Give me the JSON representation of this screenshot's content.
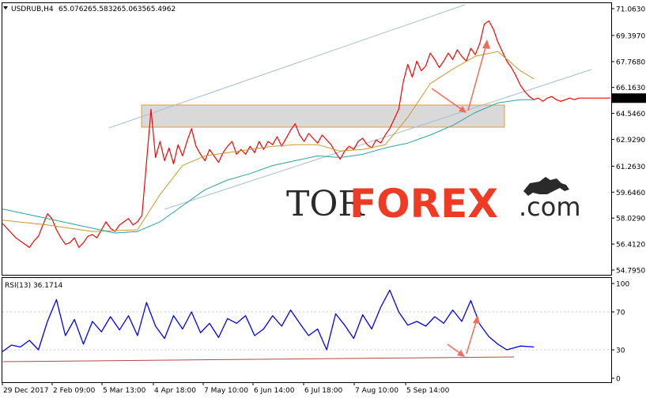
{
  "chart_data": [
    {
      "type": "line",
      "panel": "price",
      "title": "USDRUB,H4",
      "ohlc_header": [
        "65.0762",
        "65.5832",
        "65.0635",
        "65.4962"
      ],
      "y_tick_labels": [
        "71.0630",
        "69.3970",
        "67.7680",
        "66.1630",
        "65.4962",
        "64.5460",
        "62.9290",
        "61.2630",
        "59.6460",
        "58.0290",
        "56.4120",
        "54.7950"
      ],
      "last_price": "65.4962",
      "ylim": [
        54.795,
        71.063
      ],
      "x_tick_labels": [
        "29 Dec 2017",
        "2 Feb 09:00",
        "5 Mar 13:00",
        "4 Apr 18:00",
        "7 May 10:00",
        "6 Jun 14:00",
        "6 Jul 18:00",
        "7 Aug 10:00",
        "5 Sep 14:00"
      ],
      "series": [
        {
          "color": "#ff0000",
          "x": [
            0,
            2,
            4,
            6,
            8,
            10,
            12,
            14,
            16,
            18,
            20,
            22,
            24,
            26,
            28,
            30,
            32,
            34,
            36,
            38,
            40,
            42,
            44,
            46,
            48,
            50,
            52,
            54,
            56,
            58,
            60,
            62,
            64,
            66,
            68,
            70,
            72,
            74,
            76,
            78,
            80,
            82,
            84,
            86,
            88,
            90,
            92,
            94,
            96,
            98,
            100,
            102,
            104,
            106,
            108,
            110,
            112,
            114,
            116,
            118,
            120,
            122,
            124,
            126,
            128,
            130,
            132,
            134,
            136,
            138,
            140,
            142,
            144,
            146,
            148,
            150,
            152,
            154,
            156,
            158,
            160,
            162,
            164,
            166,
            168,
            170,
            172,
            174,
            176,
            178,
            180,
            182,
            184,
            186,
            188,
            190,
            192,
            194,
            196,
            198,
            200,
            202,
            204,
            206,
            208,
            210,
            212,
            214,
            216,
            218,
            220,
            222,
            224,
            226,
            228,
            230,
            232,
            234,
            236,
            238,
            240,
            242,
            244,
            246,
            248,
            250,
            252,
            254,
            256,
            258,
            260,
            262,
            264,
            266,
            268,
            270
          ],
          "y": [
            57.7,
            57.4,
            57.1,
            56.8,
            56.6,
            56.4,
            56.2,
            56.6,
            56.9,
            57.6,
            58.3,
            58.0,
            57.3,
            56.8,
            56.4,
            56.5,
            56.8,
            56.2,
            56.5,
            56.9,
            57.0,
            56.8,
            57.3,
            57.8,
            57.4,
            57.2,
            57.6,
            57.8,
            58.0,
            57.6,
            57.8,
            58.2,
            61.5,
            64.8,
            61.8,
            62.8,
            61.6,
            62.4,
            61.4,
            62.6,
            61.9,
            62.8,
            63.6,
            62.5,
            62.0,
            61.6,
            62.3,
            61.9,
            61.5,
            62.1,
            62.5,
            62.8,
            62.0,
            62.3,
            62.0,
            62.5,
            62.1,
            62.8,
            62.3,
            62.8,
            62.6,
            63.1,
            62.5,
            63.0,
            63.5,
            63.9,
            63.2,
            62.8,
            63.3,
            63.0,
            62.7,
            63.2,
            62.9,
            62.6,
            62.1,
            61.7,
            62.2,
            62.5,
            62.3,
            62.8,
            63.0,
            62.6,
            62.4,
            62.9,
            62.7,
            63.2,
            63.6,
            64.2,
            64.8,
            66.5,
            67.6,
            66.8,
            67.8,
            67.2,
            67.5,
            68.3,
            67.9,
            67.4,
            67.8,
            68.3,
            67.9,
            68.5,
            68.1,
            67.8,
            68.6,
            68.2,
            68.9,
            70.1,
            70.3,
            69.8,
            69.0,
            68.4,
            67.8,
            67.4,
            66.9,
            66.3,
            65.9,
            65.6,
            65.4,
            65.5,
            65.3,
            65.5,
            65.6,
            65.4,
            65.3,
            65.4,
            65.5,
            65.4,
            65.5,
            65.5,
            65.5,
            65.5,
            65.5,
            65.5,
            65.5,
            65.5
          ]
        },
        {
          "color": "#c79a2b",
          "x": [
            0,
            20,
            40,
            60,
            70,
            80,
            90,
            100,
            110,
            120,
            130,
            140,
            150,
            160,
            170,
            180,
            190,
            200,
            210,
            220,
            230,
            236
          ],
          "y": [
            57.9,
            57.6,
            57.2,
            57.3,
            59.5,
            61.3,
            61.9,
            62.1,
            62.3,
            62.5,
            62.6,
            62.6,
            62.2,
            62.3,
            62.6,
            64.3,
            66.4,
            67.3,
            68.1,
            68.4,
            67.2,
            66.7
          ]
        },
        {
          "color": "#2aa3a3",
          "x": [
            0,
            20,
            40,
            50,
            60,
            70,
            80,
            90,
            100,
            110,
            120,
            130,
            140,
            150,
            160,
            170,
            180,
            190,
            200,
            210,
            220,
            230,
            236
          ],
          "y": [
            58.6,
            58.0,
            57.4,
            57.1,
            57.2,
            57.8,
            58.8,
            59.8,
            60.4,
            60.8,
            61.3,
            61.6,
            61.9,
            61.8,
            62.0,
            62.4,
            62.7,
            63.2,
            63.8,
            64.6,
            65.2,
            65.4,
            65.4
          ]
        }
      ]
    },
    {
      "type": "line",
      "panel": "indicator",
      "title": "RSI(13) 36.1714",
      "y_tick_labels": [
        "100",
        "70",
        "30",
        "0"
      ],
      "ylim": [
        0,
        100
      ],
      "series": [
        {
          "color": "#0000ff",
          "x": [
            0,
            4,
            8,
            12,
            16,
            20,
            24,
            28,
            32,
            36,
            40,
            44,
            48,
            52,
            56,
            60,
            64,
            68,
            72,
            76,
            80,
            84,
            88,
            92,
            96,
            100,
            104,
            108,
            112,
            116,
            120,
            124,
            128,
            132,
            136,
            140,
            144,
            148,
            152,
            156,
            160,
            164,
            168,
            172,
            176,
            180,
            184,
            188,
            192,
            196,
            200,
            204,
            208,
            212,
            216,
            220,
            224,
            230,
            236
          ],
          "y": [
            28,
            35,
            33,
            40,
            30,
            60,
            83,
            45,
            62,
            36,
            60,
            49,
            65,
            51,
            66,
            45,
            80,
            55,
            42,
            66,
            52,
            70,
            48,
            58,
            43,
            63,
            58,
            66,
            45,
            52,
            66,
            55,
            72,
            58,
            45,
            52,
            30,
            68,
            56,
            42,
            67,
            52,
            75,
            93,
            70,
            56,
            60,
            55,
            65,
            58,
            72,
            60,
            82,
            57,
            44,
            36,
            30,
            34,
            33
          ]
        }
      ]
    }
  ]
}
